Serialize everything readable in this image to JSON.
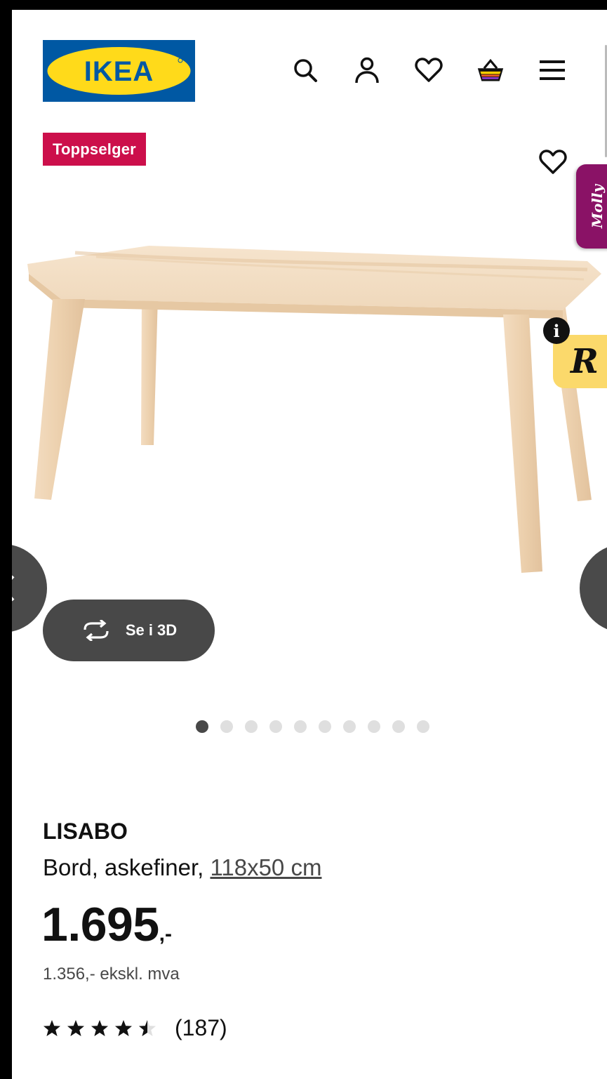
{
  "header": {
    "logo_text": "IKEA",
    "icons": [
      "search-icon",
      "account-icon",
      "wishlist-icon",
      "cart-icon",
      "menu-icon"
    ]
  },
  "badge": {
    "label": "Toppselger",
    "color": "#cc0f4b"
  },
  "widgets": {
    "molly_label": "Molly",
    "info_label": "i",
    "r_label": "R"
  },
  "gallery": {
    "view_3d_label": "Se i 3D",
    "total_images": 10,
    "active_index": 0
  },
  "product": {
    "name": "LISABO",
    "description": "Bord, askefiner,",
    "size_link": "118x50 cm",
    "price": "1.695",
    "price_suffix": ",-",
    "price_ex_vat": "1.356,- ekskl. mva",
    "rating": 4.5,
    "rating_max": 5,
    "review_count": "(187)"
  },
  "colors": {
    "ikea_blue": "#0058a3",
    "ikea_yellow": "#ffda1a",
    "button_dark": "#484848"
  }
}
